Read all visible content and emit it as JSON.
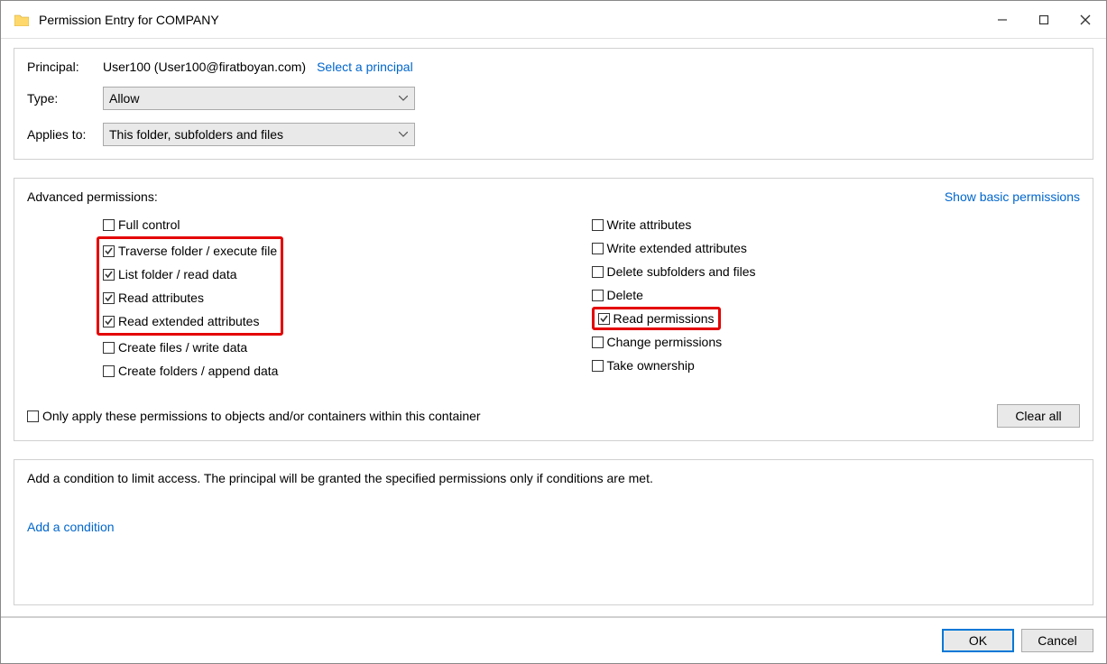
{
  "window": {
    "title": "Permission Entry for COMPANY"
  },
  "top": {
    "principal_label": "Principal:",
    "principal_value": "User100 (User100@firatboyan.com)",
    "select_principal": "Select a principal",
    "type_label": "Type:",
    "type_value": "Allow",
    "applies_label": "Applies to:",
    "applies_value": "This folder, subfolders and files"
  },
  "mid": {
    "heading": "Advanced permissions:",
    "show_basic": "Show basic permissions",
    "left": [
      {
        "label": "Full control",
        "checked": false
      },
      {
        "label": "Traverse folder / execute file",
        "checked": true
      },
      {
        "label": "List folder / read data",
        "checked": true
      },
      {
        "label": "Read attributes",
        "checked": true
      },
      {
        "label": "Read extended attributes",
        "checked": true
      },
      {
        "label": "Create files / write data",
        "checked": false
      },
      {
        "label": "Create folders / append data",
        "checked": false
      }
    ],
    "right": [
      {
        "label": "Write attributes",
        "checked": false
      },
      {
        "label": "Write extended attributes",
        "checked": false
      },
      {
        "label": "Delete subfolders and files",
        "checked": false
      },
      {
        "label": "Delete",
        "checked": false
      },
      {
        "label": "Read permissions",
        "checked": true
      },
      {
        "label": "Change permissions",
        "checked": false
      },
      {
        "label": "Take ownership",
        "checked": false
      }
    ],
    "only_apply": "Only apply these permissions to objects and/or containers within this container",
    "clear_all": "Clear all"
  },
  "bot": {
    "description": "Add a condition to limit access. The principal will be granted the specified permissions only if conditions are met.",
    "add_condition": "Add a condition"
  },
  "footer": {
    "ok": "OK",
    "cancel": "Cancel"
  }
}
